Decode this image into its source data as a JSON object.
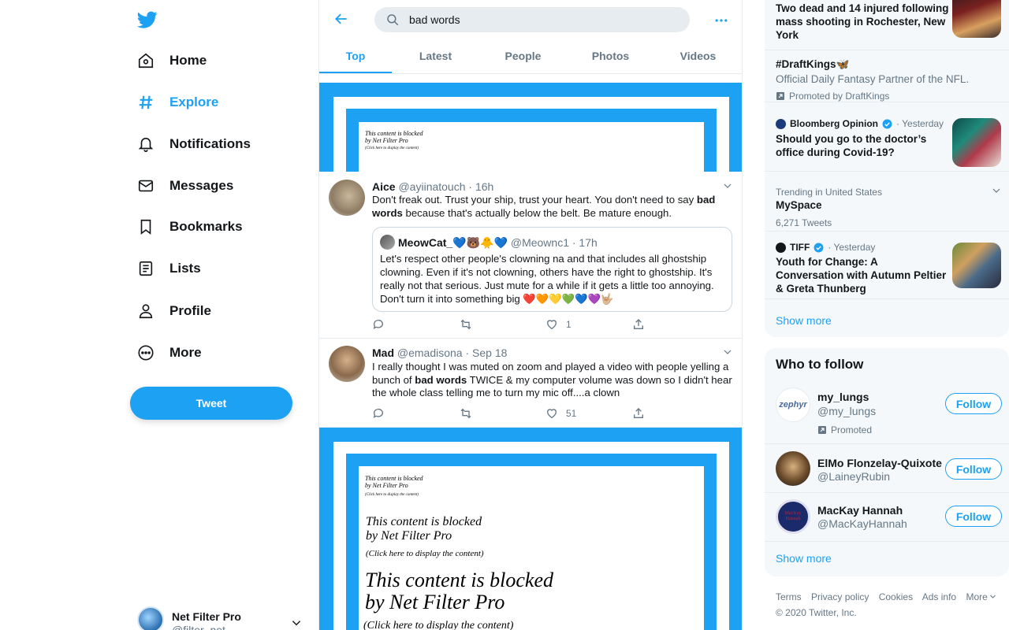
{
  "nav": {
    "items": [
      {
        "label": "Home",
        "icon": "home-icon"
      },
      {
        "label": "Explore",
        "icon": "hashtag-icon"
      },
      {
        "label": "Notifications",
        "icon": "bell-icon"
      },
      {
        "label": "Messages",
        "icon": "envelope-icon"
      },
      {
        "label": "Bookmarks",
        "icon": "bookmark-icon"
      },
      {
        "label": "Lists",
        "icon": "list-icon"
      },
      {
        "label": "Profile",
        "icon": "person-icon"
      },
      {
        "label": "More",
        "icon": "more-circle-icon"
      }
    ],
    "tweet_label": "Tweet",
    "account": {
      "name": "Net Filter Pro",
      "handle": "@filter_net"
    }
  },
  "search": {
    "value": "bad words"
  },
  "tabs": [
    "Top",
    "Latest",
    "People",
    "Photos",
    "Videos"
  ],
  "blocked": {
    "line1": "This content is blocked",
    "line2": "by Net Filter Pro",
    "hint": "(Click here to display the content)"
  },
  "tweets": [
    {
      "name": "Aice",
      "handle": "@ayiinatouch · 16h",
      "body_pre": "Don't freak out. Trust your ship, trust your heart. You don't need to say ",
      "body_bold": "bad words",
      "body_post": " because that's actually below the belt. Be mature enough.",
      "quote": {
        "name": "MeowCat_💙🐻🐥💙",
        "handle": "@Meownc1 · 17h",
        "body": "Let's respect other people's clowning na and that includes all ghostship clowning. Even if it's not clowning, others have the right to  ghostship. It's really not that serious. Just mute for a while if it gets a little too annoying. Don't turn it into something big ❤️🧡💛💚💙💜🤟🏼"
      },
      "likes": "1"
    },
    {
      "name": "Mad",
      "handle": "@emadisona · Sep 18",
      "body_pre": "I really thought I was muted on zoom and played a video with people yelling a bunch of ",
      "body_bold": "bad words",
      "body_post": " TWICE & my computer volume was down so I didn't hear the whole class telling me to turn my mic off....a clown",
      "likes": "51"
    }
  ],
  "trends": [
    {
      "title": "Two dead and 14 injured following mass shooting in Rochester, New York"
    },
    {
      "title": "#DraftKings🦋",
      "sub": "Official Daily Fantasy Partner of the NFL.",
      "meta": "Promoted by DraftKings"
    },
    {
      "meta_name": "Bloomberg Opinion",
      "meta": "· Yesterday",
      "title": "Should you go to the doctor’s office during Covid-19?"
    },
    {
      "meta": "Trending in United States",
      "title": "MySpace",
      "sub": "6,271 Tweets"
    },
    {
      "meta_name": "TIFF",
      "meta": "· Yesterday",
      "title": "Youth for Change: A Conversation with Autumn Peltier & Greta Thunberg"
    }
  ],
  "show_more": "Show more",
  "who_to_follow": {
    "title": "Who to follow",
    "users": [
      {
        "name": "my_lungs",
        "handle": "@my_lungs",
        "promoted": "Promoted",
        "avatar_text": "zephyr"
      },
      {
        "name": "ElMo Flonzelay-Quixote",
        "handle": "@LaineyRubin"
      },
      {
        "name": "MacKay Hannah",
        "handle": "@MacKayHannah",
        "avatar_text": "MacKay Hannah"
      }
    ],
    "follow_label": "Follow"
  },
  "footer": {
    "links": [
      "Terms",
      "Privacy policy",
      "Cookies",
      "Ads info",
      "More"
    ],
    "copyright": "© 2020 Twitter, Inc."
  },
  "colors": {
    "accent": "#1da1f2",
    "text": "#14171a",
    "muted": "#657786"
  }
}
